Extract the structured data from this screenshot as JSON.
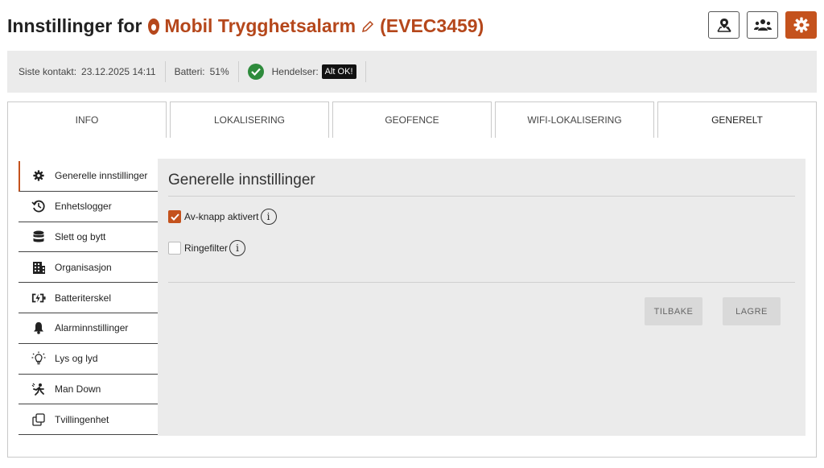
{
  "header": {
    "title_static": "Innstillinger for",
    "device_name": "Mobil Trygghetsalarm",
    "device_id": "(EVEC3459)",
    "buttons": [
      {
        "icon": "map-pin-icon"
      },
      {
        "icon": "users-icon"
      },
      {
        "icon": "gear-icon",
        "active": true
      }
    ]
  },
  "status": {
    "last_contact_label": "Siste kontakt:",
    "last_contact_value": "23.12.2025 14:11",
    "battery_label": "Batteri:",
    "battery_value": "51%",
    "events_label": "Hendelser:",
    "events_badge": "Alt OK!"
  },
  "tabs": [
    {
      "label": "INFO"
    },
    {
      "label": "LOKALISERING"
    },
    {
      "label": "GEOFENCE"
    },
    {
      "label": "WIFI-LOKALISERING"
    },
    {
      "label": "GENERELT",
      "active": true
    }
  ],
  "sidebar": {
    "items": [
      {
        "label": "Generelle innstillinger",
        "icon": "gear-icon",
        "active": true
      },
      {
        "label": "Enhetslogger",
        "icon": "history-icon"
      },
      {
        "label": "Slett og bytt",
        "icon": "database-icon"
      },
      {
        "label": "Organisasjon",
        "icon": "building-icon"
      },
      {
        "label": "Batteriterskel",
        "icon": "battery-charging-icon"
      },
      {
        "label": "Alarminnstillinger",
        "icon": "bell-icon"
      },
      {
        "label": "Lys og lyd",
        "icon": "lightbulb-icon"
      },
      {
        "label": "Man Down",
        "icon": "person-falling-icon"
      },
      {
        "label": "Tvillingenhet",
        "icon": "clone-icon"
      }
    ]
  },
  "panel": {
    "title": "Generelle innstillinger",
    "options": [
      {
        "label": "Av-knapp aktivert",
        "checked": true
      },
      {
        "label": "Ringefilter",
        "checked": false
      }
    ],
    "info_glyph": "i",
    "back_label": "TILBAKE",
    "save_label": "LAGRE"
  },
  "colors": {
    "accent": "#c4521d",
    "title_accent": "#b5471b",
    "ok_green": "#2e8b3c"
  }
}
